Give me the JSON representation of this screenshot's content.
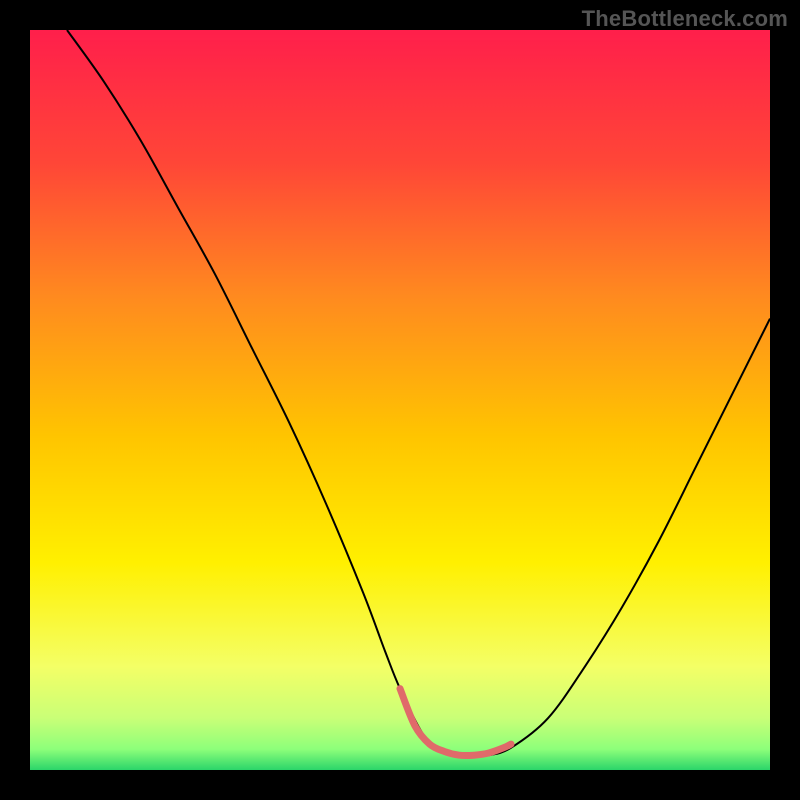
{
  "watermark": "TheBottleneck.com",
  "chart_data": {
    "type": "line",
    "title": "",
    "xlabel": "",
    "ylabel": "",
    "xlim": [
      0,
      100
    ],
    "ylim": [
      0,
      100
    ],
    "grid": false,
    "legend": false,
    "background_gradient": {
      "direction": "vertical",
      "stops": [
        {
          "pos": 0.0,
          "color": "#ff1f4b"
        },
        {
          "pos": 0.18,
          "color": "#ff4637"
        },
        {
          "pos": 0.36,
          "color": "#ff8a1f"
        },
        {
          "pos": 0.55,
          "color": "#ffc500"
        },
        {
          "pos": 0.72,
          "color": "#fff000"
        },
        {
          "pos": 0.86,
          "color": "#f4ff66"
        },
        {
          "pos": 0.93,
          "color": "#c9ff77"
        },
        {
          "pos": 0.972,
          "color": "#8dff7a"
        },
        {
          "pos": 1.0,
          "color": "#2bd56a"
        }
      ]
    },
    "series": [
      {
        "name": "curve",
        "stroke": "#000000",
        "stroke_width": 2,
        "x": [
          5,
          10,
          15,
          20,
          25,
          30,
          35,
          40,
          45,
          48,
          50,
          53,
          55,
          58,
          60,
          62,
          65,
          70,
          75,
          80,
          85,
          90,
          95,
          100
        ],
        "y": [
          100,
          93,
          85,
          76,
          67,
          57,
          47,
          36,
          24,
          16,
          11,
          5,
          3,
          2,
          2,
          2,
          3,
          7,
          14,
          22,
          31,
          41,
          51,
          61
        ]
      },
      {
        "name": "bottom-highlight",
        "stroke": "#e06a6a",
        "stroke_width": 7,
        "linecap": "round",
        "x": [
          50,
          52,
          54,
          56,
          58,
          60,
          62,
          64,
          65
        ],
        "y": [
          11,
          6,
          3.5,
          2.5,
          2,
          2,
          2.3,
          3,
          3.5
        ]
      }
    ]
  }
}
